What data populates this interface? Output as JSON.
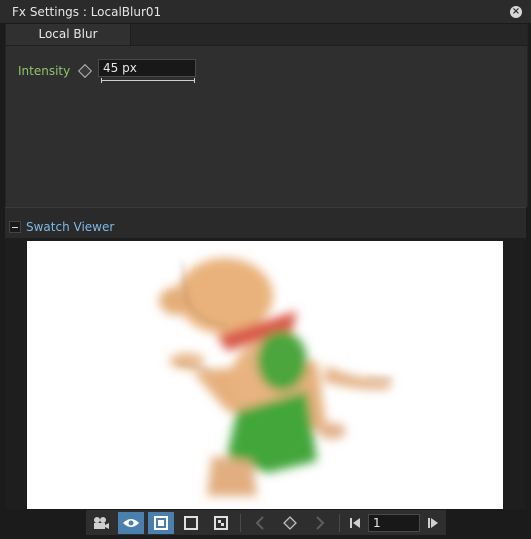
{
  "window": {
    "title": "Fx Settings : LocalBlur01"
  },
  "tabs": [
    {
      "label": "Local Blur"
    }
  ],
  "params": {
    "intensity_label": "Intensity",
    "intensity_value": "45 px"
  },
  "swatch": {
    "label": "Swatch Viewer"
  },
  "toolbar": {
    "frame_value": "1"
  },
  "colors": {
    "accent": "#4b7fae",
    "param_label": "#8ec56a",
    "swatch_label": "#7fb9e8"
  },
  "icons": [
    "close-icon",
    "keyframe-icon",
    "collapse-icon",
    "camera-icon",
    "eye-icon",
    "preview-icon",
    "frame-icon",
    "checker-icon",
    "prev-key-icon",
    "key-icon",
    "next-key-icon",
    "prev-frame-icon",
    "next-frame-icon"
  ]
}
